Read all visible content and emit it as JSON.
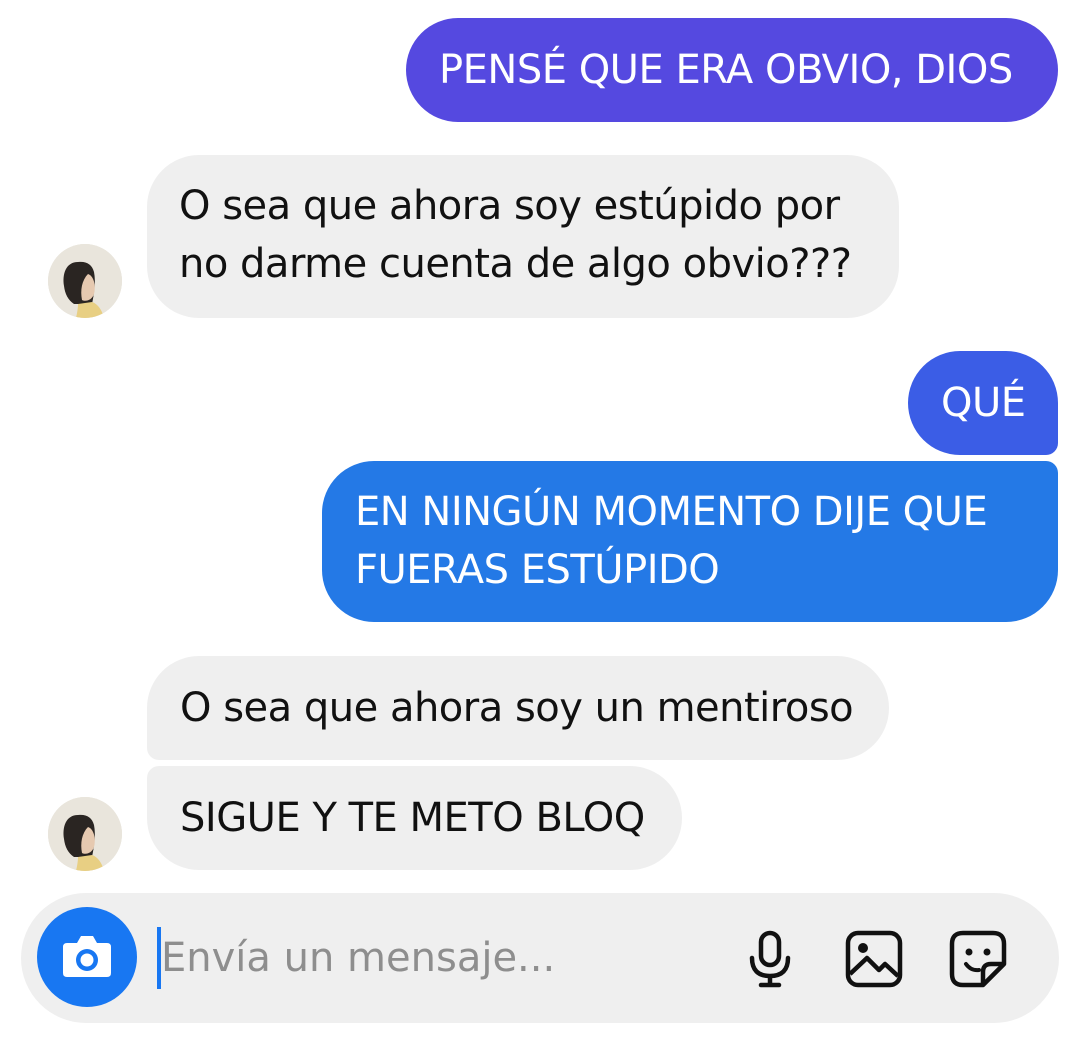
{
  "messages": [
    {
      "side": "out",
      "text": "PENSÉ QUE ERA OBVIO, DIOS"
    },
    {
      "side": "in",
      "text": "O sea que ahora soy estúpido por no darme cuenta de algo obvio???"
    },
    {
      "side": "out",
      "text": "QUÉ"
    },
    {
      "side": "out",
      "text": "EN NINGÚN MOMENTO DIJE QUE FUERAS ESTÚPIDO"
    },
    {
      "side": "in",
      "text": "O sea que ahora soy un mentiroso"
    },
    {
      "side": "in",
      "text": "SIGUE Y TE METO BLOQ"
    }
  ],
  "composer": {
    "placeholder": "Envía un mensaje...",
    "value": "",
    "icons": [
      "camera-icon",
      "microphone-icon",
      "image-icon",
      "sticker-icon"
    ]
  },
  "colors": {
    "outgoing_1": "#5549e0",
    "outgoing_2": "#3b5de6",
    "outgoing_3": "#2479e6",
    "incoming": "#efefef",
    "accent": "#1877f2"
  }
}
